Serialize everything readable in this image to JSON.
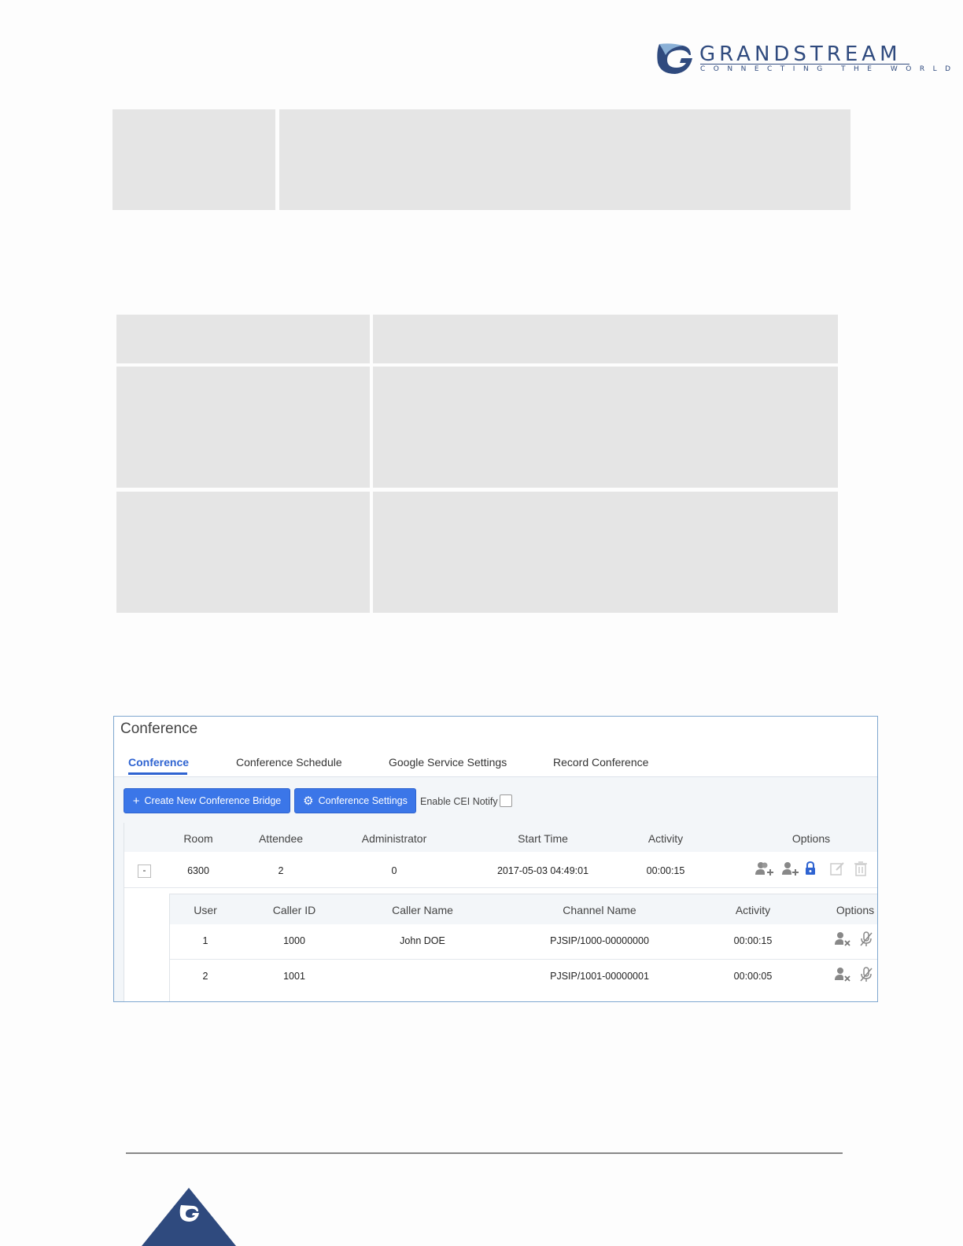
{
  "header": {
    "brand_name": "GRANDSTREAM",
    "tagline": "CONNECTING THE WORLD",
    "brand_color": "#2f4a7e"
  },
  "conference_panel": {
    "title": "Conference",
    "tabs": [
      {
        "label": "Conference",
        "active": true
      },
      {
        "label": "Conference Schedule",
        "active": false
      },
      {
        "label": "Google Service Settings",
        "active": false
      },
      {
        "label": "Record Conference",
        "active": false
      }
    ],
    "toolbar": {
      "create_button": "Create New Conference Bridge",
      "settings_button": "Conference Settings",
      "cei_label": "Enable CEI Notify",
      "cei_checked": false
    },
    "rooms_table": {
      "columns": [
        "Room",
        "Attendee",
        "Administrator",
        "Start Time",
        "Activity",
        "Options"
      ],
      "rows": [
        {
          "expander": "-",
          "room": "6300",
          "attendee": "2",
          "administrator": "0",
          "start_time": "2017-05-03 04:49:01",
          "activity": "00:00:15"
        }
      ]
    },
    "participants_table": {
      "columns": [
        "User",
        "Caller ID",
        "Caller Name",
        "Channel Name",
        "Activity",
        "Options"
      ],
      "rows": [
        {
          "user": "1",
          "caller_id": "1000",
          "caller_name": "John DOE",
          "channel_name": "PJSIP/1000-00000000",
          "activity": "00:00:15"
        },
        {
          "user": "2",
          "caller_id": "1001",
          "caller_name": "",
          "channel_name": "PJSIP/1001-00000001",
          "activity": "00:00:05"
        }
      ]
    },
    "accent_color": "#3b76e8"
  }
}
